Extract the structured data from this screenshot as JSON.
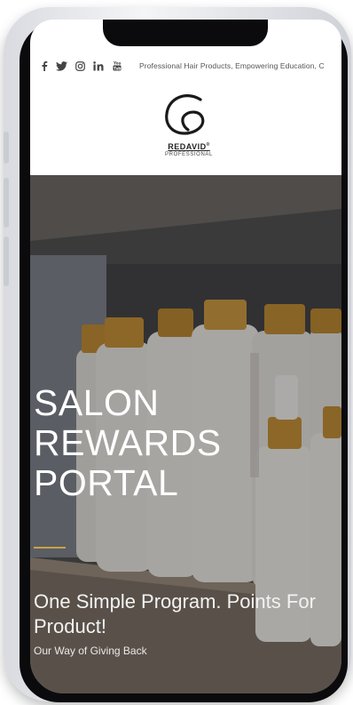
{
  "topbar": {
    "social_icons": [
      {
        "name": "facebook-icon",
        "glyph": "f"
      },
      {
        "name": "twitter-icon",
        "glyph": "🐦"
      },
      {
        "name": "instagram-icon",
        "glyph": "◎"
      },
      {
        "name": "linkedin-icon",
        "glyph": "in"
      },
      {
        "name": "youtube-icon",
        "glyph": "You Tube"
      }
    ],
    "tagline": "Professional Hair Products, Empowering Education, C"
  },
  "brand": {
    "name": "REDAVID",
    "trademark": "®",
    "sub": "PROFESSIONAL"
  },
  "hero": {
    "title": "SALON\nREWARDS\nPORTAL",
    "subtitle": "One Simple Program. Points For Product!",
    "subsubtitle": "Our Way of Giving Back"
  },
  "colors": {
    "accent_gold": "#c9a24a",
    "hero_text": "#ffffff",
    "bottle_white": "#f1efec",
    "cap_gold": "#c48a2c"
  }
}
